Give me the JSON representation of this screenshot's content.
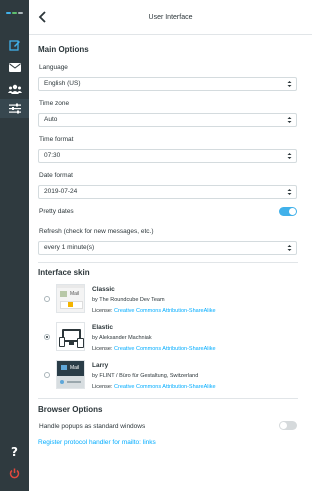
{
  "rail": {
    "nav": [
      {
        "name": "compose-icon"
      },
      {
        "name": "mail-icon"
      },
      {
        "name": "contacts-icon"
      },
      {
        "name": "settings-icon"
      }
    ],
    "help_icon": "help-icon",
    "logout_icon": "power-icon",
    "accent": "#41b1ea"
  },
  "header": {
    "title": "User Interface"
  },
  "main_options": {
    "heading": "Main Options",
    "language": {
      "label": "Language",
      "value": "English (US)"
    },
    "timezone": {
      "label": "Time zone",
      "value": "Auto"
    },
    "time_format": {
      "label": "Time format",
      "value": "07:30"
    },
    "date_format": {
      "label": "Date format",
      "value": "2019-07-24"
    },
    "pretty_dates": {
      "label": "Pretty dates",
      "enabled": true
    },
    "refresh": {
      "label": "Refresh (check for new messages, etc.)",
      "value": "every 1 minute(s)"
    }
  },
  "skin": {
    "heading": "Interface skin",
    "items": [
      {
        "name": "Classic",
        "author": "by The Roundcube Dev Team",
        "license_prefix": "License: ",
        "license": "Creative Commons Attribution-ShareAlike",
        "selected": false
      },
      {
        "name": "Elastic",
        "author": "by Aleksander Machniak",
        "license_prefix": "License: ",
        "license": "Creative Commons Attribution-ShareAlike",
        "selected": true
      },
      {
        "name": "Larry",
        "author": "by FLINT / Büro für Gestaltung, Switzerland",
        "license_prefix": "License: ",
        "license": "Creative Commons Attribution-ShareAlike",
        "selected": false
      }
    ]
  },
  "browser": {
    "heading": "Browser Options",
    "popups": {
      "label": "Handle popups as standard windows",
      "enabled": false
    },
    "mailto_link": "Register protocol handler for mailto: links"
  },
  "colors": {
    "link": "#00acff",
    "toggle_on": "#41b1ea",
    "toggle_off": "#d6dadc"
  }
}
